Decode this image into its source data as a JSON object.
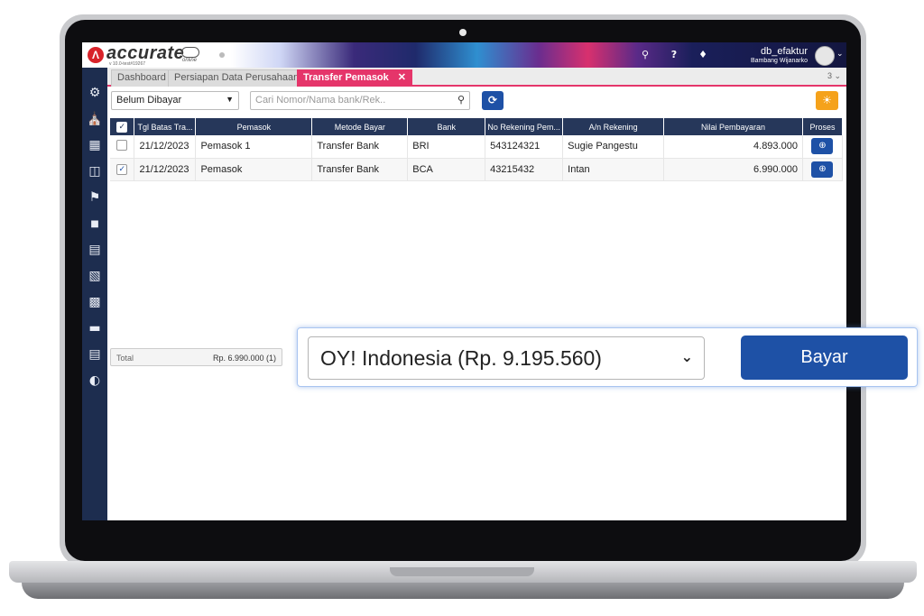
{
  "brand": {
    "logo_letter": "^",
    "name": "accurate",
    "version": "v 10.0-test#19267",
    "tagline": "online"
  },
  "user": {
    "db": "db_efaktur",
    "name": "Bambang Wijanarko"
  },
  "tabs": [
    {
      "label": "Dashboard"
    },
    {
      "label": "Persiapan Data Perusahaan"
    },
    {
      "label": "Transfer Pemasok",
      "close": "✕"
    }
  ],
  "tab_count": "3 ⌄",
  "filter": {
    "status": "Belum Dibayar",
    "search_placeholder": "Cari Nomor/Nama bank/Rek.."
  },
  "table": {
    "columns": [
      "Tgl Batas Tra...",
      "Pemasok",
      "Metode Bayar",
      "Bank",
      "No Rekening Pem...",
      "A/n Rekening",
      "Nilai Pembayaran",
      "Proses"
    ],
    "rows": [
      {
        "checked": false,
        "date": "21/12/2023",
        "supplier": "Pemasok 1",
        "method": "Transfer Bank",
        "bank": "BRI",
        "account_no": "543124321",
        "account_name": "Sugie Pangestu",
        "amount": "4.893.000"
      },
      {
        "checked": true,
        "date": "21/12/2023",
        "supplier": "Pemasok",
        "method": "Transfer Bank",
        "bank": "BCA",
        "account_no": "43215432",
        "account_name": "Intan",
        "amount": "6.990.000"
      }
    ]
  },
  "footer": {
    "total_label": "Total",
    "total_value": "Rp. 6.990.000 (1)"
  },
  "callout": {
    "payment_source": "OY! Indonesia (Rp. 9.195.560)",
    "pay_button": "Bayar"
  },
  "icons": [
    "gear-icon",
    "building-icon",
    "office-icon",
    "phone-icon",
    "bank-icon",
    "bag-icon",
    "cart-icon",
    "trolley-icon",
    "factory-icon",
    "cash-icon",
    "report-icon",
    "chart-icon"
  ],
  "colors": {
    "sidebar": "#1d2d4f",
    "table_header": "#26375a",
    "accent_tab": "#e5356a",
    "primary_button": "#1e51a6",
    "warning_button": "#f5a21b"
  }
}
